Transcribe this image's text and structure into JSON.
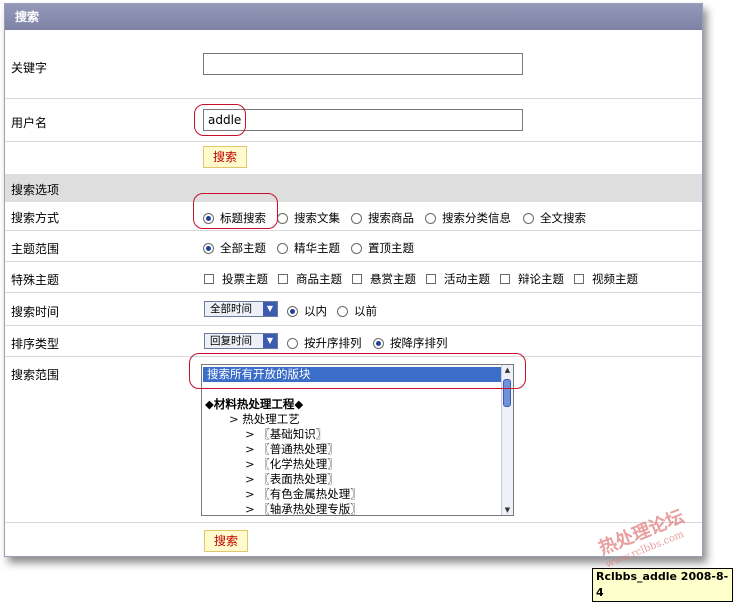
{
  "title": "搜索",
  "keyword": {
    "label": "关键字",
    "value": ""
  },
  "username": {
    "label": "用户名",
    "value": "addle"
  },
  "search_button_label": "搜索",
  "options_section": "搜索选项",
  "search_method": {
    "label": "搜索方式",
    "options": [
      "标题搜索",
      "搜索文集",
      "搜索商品",
      "搜索分类信息",
      "全文搜索"
    ],
    "selected": "标题搜索"
  },
  "topic_scope": {
    "label": "主题范围",
    "options": [
      "全部主题",
      "精华主题",
      "置顶主题"
    ],
    "selected": "全部主题"
  },
  "special_topics": {
    "label": "特殊主题",
    "options": [
      "投票主题",
      "商品主题",
      "悬赏主题",
      "活动主题",
      "辩论主题",
      "视频主题"
    ]
  },
  "search_time": {
    "label": "搜索时间",
    "select_value": "全部时间",
    "options": [
      "以内",
      "以前"
    ],
    "selected": "以内"
  },
  "sort_type": {
    "label": "排序类型",
    "select_value": "回复时间",
    "options": [
      "按升序排列",
      "按降序排列"
    ],
    "selected": "按降序排列"
  },
  "forum_scope": {
    "label": "搜索范围",
    "selected_item": "搜索所有开放的版块",
    "items": [
      "◆材料热处理工程◆",
      "> 热处理工艺",
      "> 〖基础知识〗",
      "> 〖普通热处理〗",
      "> 〖化学热处理〗",
      "> 〖表面热处理〗",
      "> 〖有色金属热处理〗",
      "> 〖轴承热处理专版〗"
    ]
  },
  "watermark": {
    "main": "热处理论坛",
    "url": "www.rclbbs.com"
  },
  "stamp": "Rclbbs_addle 2008-8-4",
  "colors": {
    "title_bar": "#8a8eb0",
    "accent_red": "#c8102e",
    "radio_dot": "#1f3f9e"
  }
}
